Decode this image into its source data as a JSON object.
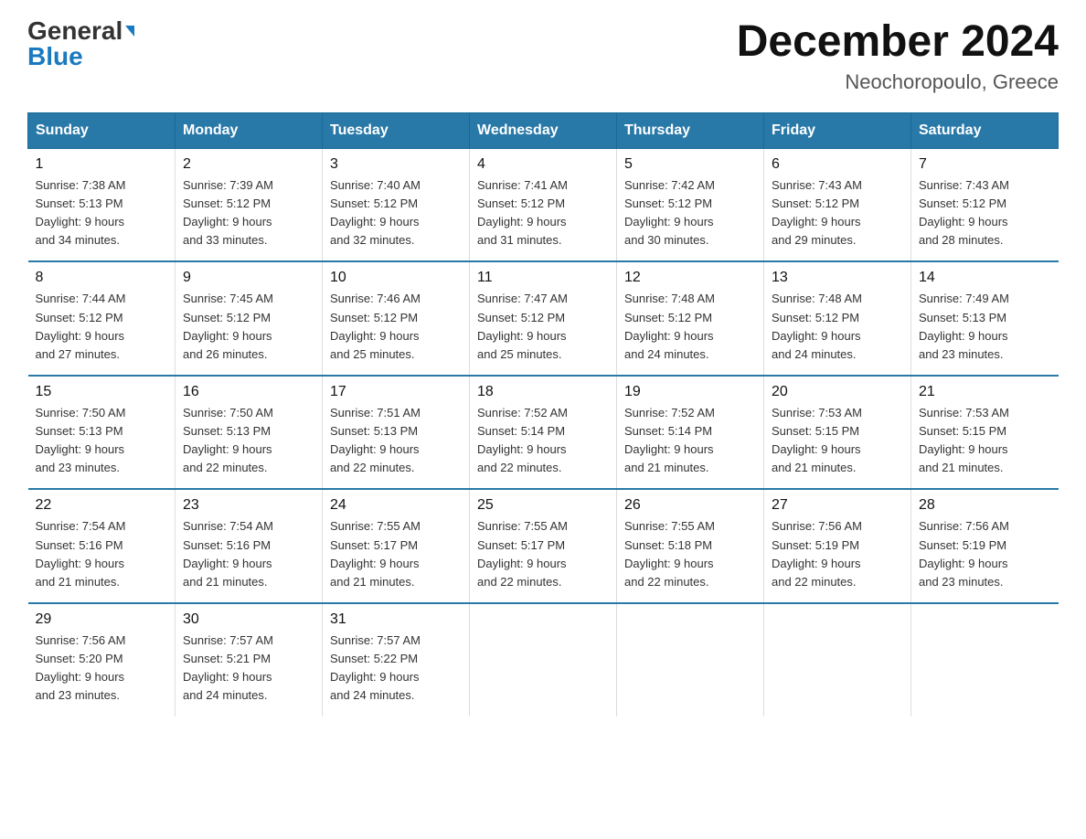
{
  "header": {
    "logo_general": "General",
    "logo_blue": "Blue",
    "title": "December 2024",
    "subtitle": "Neochoropoulo, Greece"
  },
  "columns": [
    "Sunday",
    "Monday",
    "Tuesday",
    "Wednesday",
    "Thursday",
    "Friday",
    "Saturday"
  ],
  "weeks": [
    [
      {
        "day": "1",
        "sunrise": "7:38 AM",
        "sunset": "5:13 PM",
        "daylight": "9 hours and 34 minutes."
      },
      {
        "day": "2",
        "sunrise": "7:39 AM",
        "sunset": "5:12 PM",
        "daylight": "9 hours and 33 minutes."
      },
      {
        "day": "3",
        "sunrise": "7:40 AM",
        "sunset": "5:12 PM",
        "daylight": "9 hours and 32 minutes."
      },
      {
        "day": "4",
        "sunrise": "7:41 AM",
        "sunset": "5:12 PM",
        "daylight": "9 hours and 31 minutes."
      },
      {
        "day": "5",
        "sunrise": "7:42 AM",
        "sunset": "5:12 PM",
        "daylight": "9 hours and 30 minutes."
      },
      {
        "day": "6",
        "sunrise": "7:43 AM",
        "sunset": "5:12 PM",
        "daylight": "9 hours and 29 minutes."
      },
      {
        "day": "7",
        "sunrise": "7:43 AM",
        "sunset": "5:12 PM",
        "daylight": "9 hours and 28 minutes."
      }
    ],
    [
      {
        "day": "8",
        "sunrise": "7:44 AM",
        "sunset": "5:12 PM",
        "daylight": "9 hours and 27 minutes."
      },
      {
        "day": "9",
        "sunrise": "7:45 AM",
        "sunset": "5:12 PM",
        "daylight": "9 hours and 26 minutes."
      },
      {
        "day": "10",
        "sunrise": "7:46 AM",
        "sunset": "5:12 PM",
        "daylight": "9 hours and 25 minutes."
      },
      {
        "day": "11",
        "sunrise": "7:47 AM",
        "sunset": "5:12 PM",
        "daylight": "9 hours and 25 minutes."
      },
      {
        "day": "12",
        "sunrise": "7:48 AM",
        "sunset": "5:12 PM",
        "daylight": "9 hours and 24 minutes."
      },
      {
        "day": "13",
        "sunrise": "7:48 AM",
        "sunset": "5:12 PM",
        "daylight": "9 hours and 24 minutes."
      },
      {
        "day": "14",
        "sunrise": "7:49 AM",
        "sunset": "5:13 PM",
        "daylight": "9 hours and 23 minutes."
      }
    ],
    [
      {
        "day": "15",
        "sunrise": "7:50 AM",
        "sunset": "5:13 PM",
        "daylight": "9 hours and 23 minutes."
      },
      {
        "day": "16",
        "sunrise": "7:50 AM",
        "sunset": "5:13 PM",
        "daylight": "9 hours and 22 minutes."
      },
      {
        "day": "17",
        "sunrise": "7:51 AM",
        "sunset": "5:13 PM",
        "daylight": "9 hours and 22 minutes."
      },
      {
        "day": "18",
        "sunrise": "7:52 AM",
        "sunset": "5:14 PM",
        "daylight": "9 hours and 22 minutes."
      },
      {
        "day": "19",
        "sunrise": "7:52 AM",
        "sunset": "5:14 PM",
        "daylight": "9 hours and 21 minutes."
      },
      {
        "day": "20",
        "sunrise": "7:53 AM",
        "sunset": "5:15 PM",
        "daylight": "9 hours and 21 minutes."
      },
      {
        "day": "21",
        "sunrise": "7:53 AM",
        "sunset": "5:15 PM",
        "daylight": "9 hours and 21 minutes."
      }
    ],
    [
      {
        "day": "22",
        "sunrise": "7:54 AM",
        "sunset": "5:16 PM",
        "daylight": "9 hours and 21 minutes."
      },
      {
        "day": "23",
        "sunrise": "7:54 AM",
        "sunset": "5:16 PM",
        "daylight": "9 hours and 21 minutes."
      },
      {
        "day": "24",
        "sunrise": "7:55 AM",
        "sunset": "5:17 PM",
        "daylight": "9 hours and 21 minutes."
      },
      {
        "day": "25",
        "sunrise": "7:55 AM",
        "sunset": "5:17 PM",
        "daylight": "9 hours and 22 minutes."
      },
      {
        "day": "26",
        "sunrise": "7:55 AM",
        "sunset": "5:18 PM",
        "daylight": "9 hours and 22 minutes."
      },
      {
        "day": "27",
        "sunrise": "7:56 AM",
        "sunset": "5:19 PM",
        "daylight": "9 hours and 22 minutes."
      },
      {
        "day": "28",
        "sunrise": "7:56 AM",
        "sunset": "5:19 PM",
        "daylight": "9 hours and 23 minutes."
      }
    ],
    [
      {
        "day": "29",
        "sunrise": "7:56 AM",
        "sunset": "5:20 PM",
        "daylight": "9 hours and 23 minutes."
      },
      {
        "day": "30",
        "sunrise": "7:57 AM",
        "sunset": "5:21 PM",
        "daylight": "9 hours and 24 minutes."
      },
      {
        "day": "31",
        "sunrise": "7:57 AM",
        "sunset": "5:22 PM",
        "daylight": "9 hours and 24 minutes."
      },
      null,
      null,
      null,
      null
    ]
  ],
  "labels": {
    "sunrise": "Sunrise:",
    "sunset": "Sunset:",
    "daylight": "Daylight:"
  }
}
